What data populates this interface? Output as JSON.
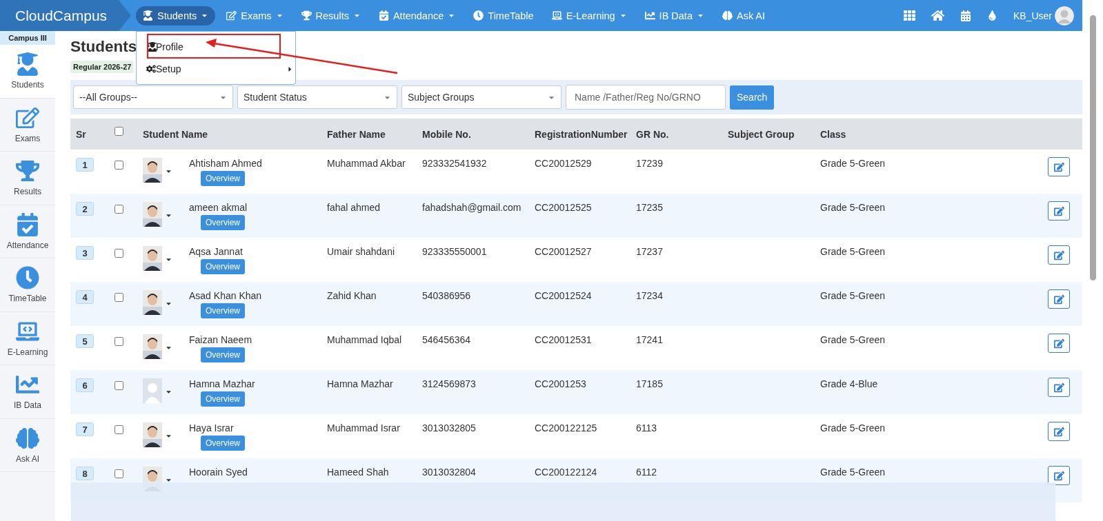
{
  "nav": {
    "brand": "CloudCampus",
    "menu": [
      {
        "label": "Students",
        "caret": true,
        "selected": true
      },
      {
        "label": "Exams",
        "caret": true,
        "selected": false
      },
      {
        "label": "Results",
        "caret": true,
        "selected": false
      },
      {
        "label": "Attendance",
        "caret": true,
        "selected": false
      },
      {
        "label": "TimeTable",
        "caret": false,
        "selected": false
      },
      {
        "label": "E-Learning",
        "caret": true,
        "selected": false
      },
      {
        "label": "IB Data",
        "caret": true,
        "selected": false
      },
      {
        "label": "Ask AI",
        "caret": false,
        "selected": false
      }
    ],
    "user": "KB_User"
  },
  "dropdown": {
    "items": [
      {
        "label": "Profile",
        "submenu": false,
        "highlighted": true
      },
      {
        "label": "Setup",
        "submenu": true,
        "highlighted": false
      }
    ]
  },
  "sidebar": {
    "campus": "Campus III",
    "items": [
      {
        "label": "Students",
        "selected": true
      },
      {
        "label": "Exams",
        "selected": false
      },
      {
        "label": "Results",
        "selected": false
      },
      {
        "label": "Attendance",
        "selected": false
      },
      {
        "label": "TimeTable",
        "selected": false
      },
      {
        "label": "E-Learning",
        "selected": false
      },
      {
        "label": "IB Data",
        "selected": false
      },
      {
        "label": "Ask AI",
        "selected": false
      }
    ]
  },
  "page": {
    "title": "Students",
    "session": "Regular 2026-27"
  },
  "filters": {
    "selects": [
      "--All Groups--",
      "Student Status",
      "Subject Groups"
    ],
    "search_placeholder": "Name /Father/Reg No/GRNO",
    "search_button": "Search"
  },
  "table": {
    "columns": [
      "Sr",
      "Student Name",
      "Father Name",
      "Mobile No.",
      "RegistrationNumber",
      "GR No.",
      "Subject Group",
      "Class"
    ],
    "select_all": false,
    "rows": [
      {
        "sr": "1",
        "checked": false,
        "overview": "Overview",
        "name": "Ahtisham Ahmed",
        "father": "Muhammad Akbar",
        "mobile": "923332541932",
        "reg": "CC20012529",
        "gr": "17239",
        "cls": "Grade 5-Green"
      },
      {
        "sr": "2",
        "checked": false,
        "overview": "Overview",
        "name": "ameen akmal",
        "father": "fahal ahmed",
        "mobile": "fahadshah@gmail.com",
        "reg": "CC20012525",
        "gr": "17235",
        "cls": "Grade 5-Green"
      },
      {
        "sr": "3",
        "checked": false,
        "overview": "Overview",
        "name": "Aqsa Jannat",
        "father": "Umair shahdani",
        "mobile": "923335550001",
        "reg": "CC20012527",
        "gr": "17237",
        "cls": "Grade 5-Green"
      },
      {
        "sr": "4",
        "checked": false,
        "overview": "Overview",
        "name": "Asad Khan Khan",
        "father": "Zahid Khan",
        "mobile": "540386956",
        "reg": "CC20012524",
        "gr": "17234",
        "cls": "Grade 5-Green"
      },
      {
        "sr": "5",
        "checked": false,
        "overview": "Overview",
        "name": "Faizan Naeem",
        "father": "Muhammad Iqbal",
        "mobile": "546456364",
        "reg": "CC20012531",
        "gr": "17241",
        "cls": "Grade 5-Green"
      },
      {
        "sr": "6",
        "checked": false,
        "photo": {
          "kind": "placeholder"
        },
        "overview": "Overview",
        "name": "Hamna Mazhar",
        "father": "Hamna Mazhar",
        "mobile": "3124569873",
        "reg": "CC2001253",
        "gr": "17185",
        "cls": "Grade 4-Blue"
      },
      {
        "sr": "7",
        "checked": false,
        "overview": "Overview",
        "name": "Haya Israr",
        "father": "Muhammad Israr",
        "mobile": "3013032805",
        "reg": "CC200122125",
        "gr": "6113",
        "cls": "Grade 5-Green"
      },
      {
        "sr": "8",
        "checked": false,
        "name": "Hoorain Syed",
        "father": "Hameed Shah",
        "mobile": "3013032804",
        "reg": "CC200122124",
        "gr": "6112",
        "cls": "Grade 5-Green"
      }
    ]
  }
}
